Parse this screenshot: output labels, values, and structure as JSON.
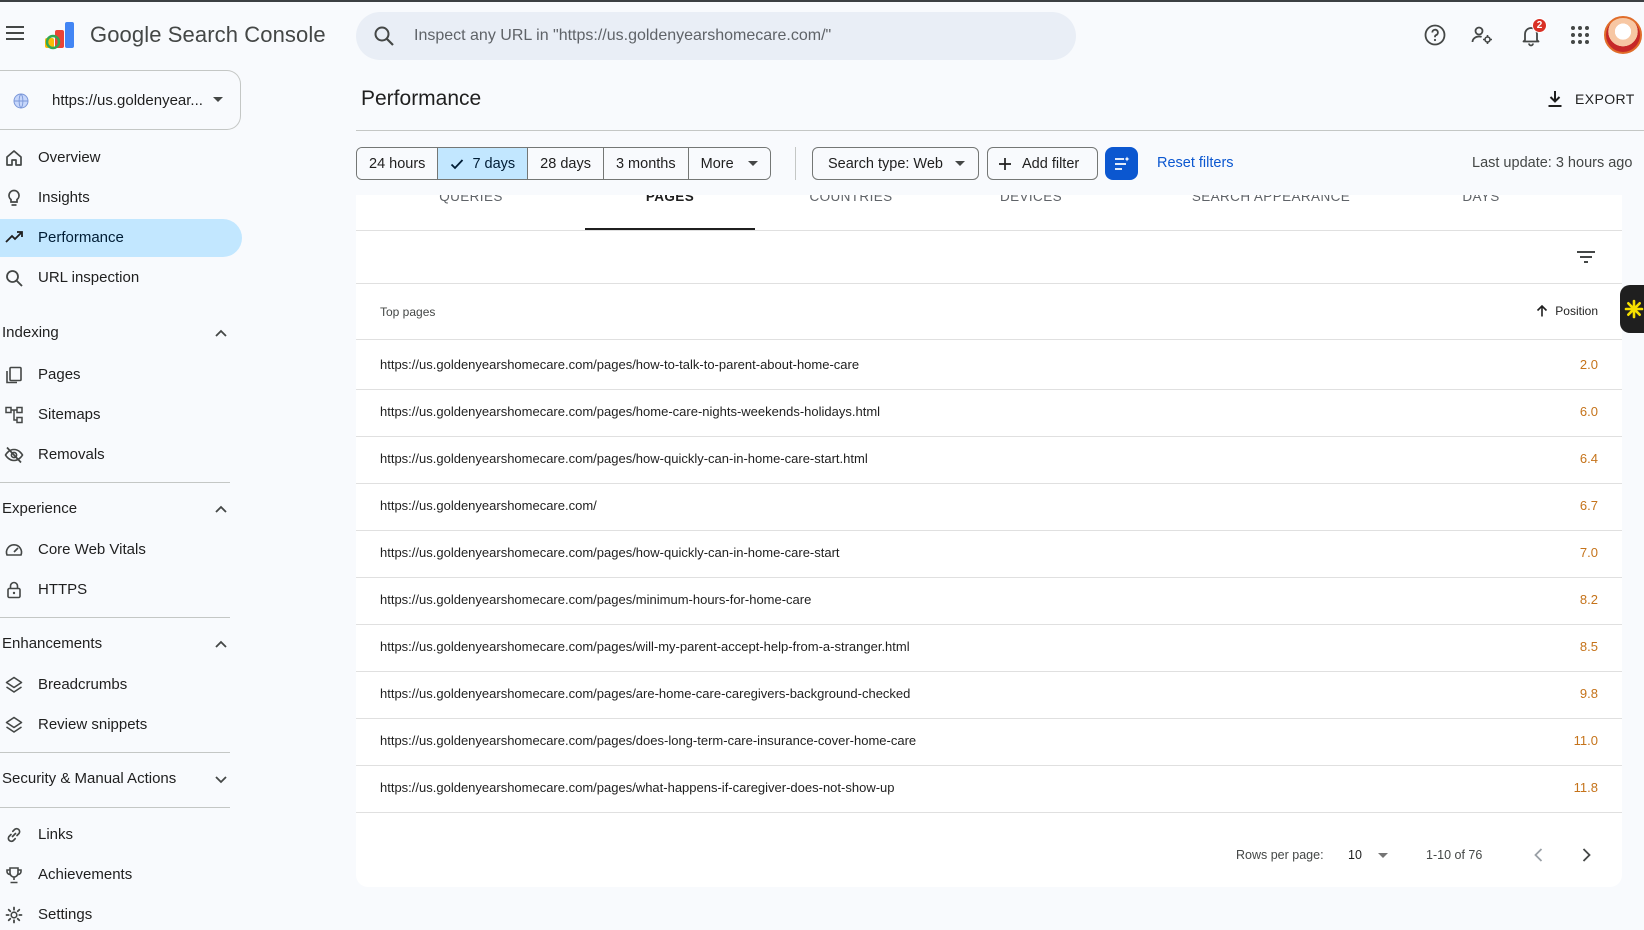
{
  "header": {
    "product_name": "Google Search Console",
    "search_placeholder": "Inspect any URL in \"https://us.goldenyearshomecare.com/\"",
    "notification_count": "2"
  },
  "sidebar": {
    "property": "https://us.goldenyear...",
    "top_items": [
      {
        "label": "Overview",
        "icon": "home-icon"
      },
      {
        "label": "Insights",
        "icon": "lightbulb-icon"
      },
      {
        "label": "Performance",
        "icon": "trending-up-icon",
        "active": true
      },
      {
        "label": "URL inspection",
        "icon": "search-icon"
      }
    ],
    "sections": [
      {
        "title": "Indexing",
        "expanded": true,
        "items": [
          {
            "label": "Pages",
            "icon": "pages-icon"
          },
          {
            "label": "Sitemaps",
            "icon": "sitemap-icon"
          },
          {
            "label": "Removals",
            "icon": "eye-off-icon"
          }
        ]
      },
      {
        "title": "Experience",
        "expanded": true,
        "items": [
          {
            "label": "Core Web Vitals",
            "icon": "speedometer-icon"
          },
          {
            "label": "HTTPS",
            "icon": "lock-icon"
          }
        ]
      },
      {
        "title": "Enhancements",
        "expanded": true,
        "items": [
          {
            "label": "Breadcrumbs",
            "icon": "layers-icon"
          },
          {
            "label": "Review snippets",
            "icon": "layers-icon"
          }
        ]
      },
      {
        "title": "Security & Manual Actions",
        "expanded": false,
        "items": []
      }
    ],
    "bottom_items": [
      {
        "label": "Links",
        "icon": "link-icon"
      },
      {
        "label": "Achievements",
        "icon": "trophy-icon"
      },
      {
        "label": "Settings",
        "icon": "gear-icon"
      }
    ]
  },
  "main": {
    "title": "Performance",
    "export_label": "EXPORT",
    "date_ranges": [
      {
        "label": "24 hours",
        "selected": false
      },
      {
        "label": "7 days",
        "selected": true
      },
      {
        "label": "28 days",
        "selected": false
      },
      {
        "label": "3 months",
        "selected": false
      },
      {
        "label": "More",
        "selected": false
      }
    ],
    "search_type": "Search type: Web",
    "add_filter": "Add filter",
    "reset_filters": "Reset filters",
    "last_update": "Last update: 3 hours ago",
    "tabs": [
      {
        "label": "QUERIES",
        "active": false
      },
      {
        "label": "PAGES",
        "active": true
      },
      {
        "label": "COUNTRIES",
        "active": false
      },
      {
        "label": "DEVICES",
        "active": false
      },
      {
        "label": "SEARCH APPEARANCE",
        "active": false
      },
      {
        "label": "DAYS",
        "active": false
      }
    ],
    "table": {
      "col_pages": "Top pages",
      "col_position": "Position",
      "sort": "ascending",
      "rows": [
        {
          "url": "https://us.goldenyearshomecare.com/pages/how-to-talk-to-parent-about-home-care",
          "position": "2.0"
        },
        {
          "url": "https://us.goldenyearshomecare.com/pages/home-care-nights-weekends-holidays.html",
          "position": "6.0"
        },
        {
          "url": "https://us.goldenyearshomecare.com/pages/how-quickly-can-in-home-care-start.html",
          "position": "6.4"
        },
        {
          "url": "https://us.goldenyearshomecare.com/",
          "position": "6.7"
        },
        {
          "url": "https://us.goldenyearshomecare.com/pages/how-quickly-can-in-home-care-start",
          "position": "7.0"
        },
        {
          "url": "https://us.goldenyearshomecare.com/pages/minimum-hours-for-home-care",
          "position": "8.2"
        },
        {
          "url": "https://us.goldenyearshomecare.com/pages/will-my-parent-accept-help-from-a-stranger.html",
          "position": "8.5"
        },
        {
          "url": "https://us.goldenyearshomecare.com/pages/are-home-care-caregivers-background-checked",
          "position": "9.8"
        },
        {
          "url": "https://us.goldenyearshomecare.com/pages/does-long-term-care-insurance-cover-home-care",
          "position": "11.0"
        },
        {
          "url": "https://us.goldenyearshomecare.com/pages/what-happens-if-caregiver-does-not-show-up",
          "position": "11.8"
        }
      ]
    },
    "pagination": {
      "rows_per_page_label": "Rows per page:",
      "rows_per_page": "10",
      "range": "1-10 of 76"
    }
  },
  "colors": {
    "accent": "#0b57d0",
    "active_nav": "#c2e7ff",
    "position_value": "#c5731a"
  }
}
